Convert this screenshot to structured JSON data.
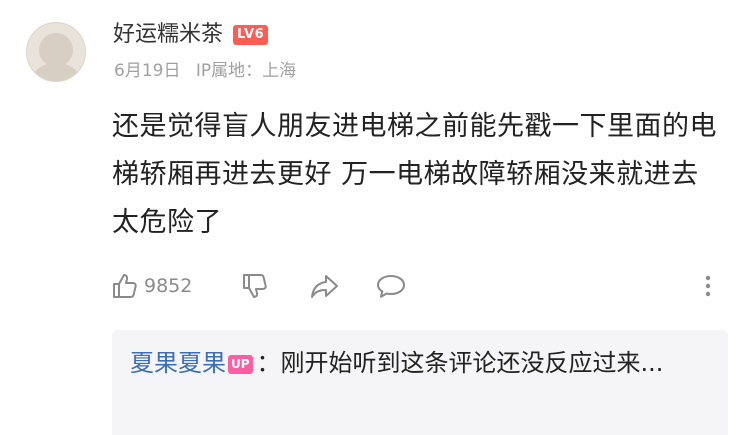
{
  "comment": {
    "username": "好运糯米茶",
    "level_badge": "LV6",
    "date": "6月19日",
    "ip_location": "IP属地：上海",
    "text": "还是觉得盲人朋友进电梯之前能先戳一下里面的电梯轿厢再进去更好 万一电梯故障轿厢没来就进去太危险了",
    "like_count": "9852"
  },
  "actions": {
    "icons": [
      "thumbs-up-icon",
      "thumbs-down-icon",
      "share-icon",
      "comment-icon",
      "more-vertical-icon"
    ]
  },
  "reply": {
    "username": "夏果夏果",
    "badge": "UP",
    "separator": "：",
    "text": "刚开始听到这条评论还没反应过来..."
  },
  "colors": {
    "level_badge": "#ff5c54",
    "up_badge": "#ff5fa2",
    "reply_name": "#3b6fb5",
    "meta_text": "#a0a0a0",
    "icon_gray": "#8a8a8a",
    "reply_background": "#f5f5f7"
  }
}
